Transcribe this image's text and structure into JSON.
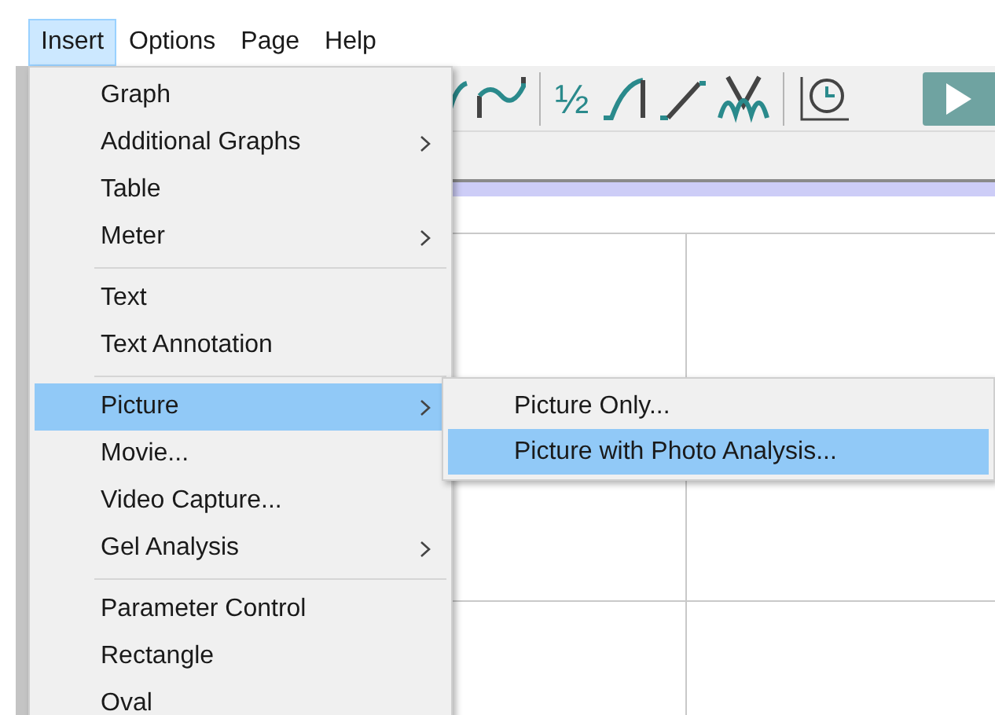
{
  "menubar": [
    {
      "label": "Insert",
      "selected": true
    },
    {
      "label": "Options",
      "selected": false
    },
    {
      "label": "Page",
      "selected": false
    },
    {
      "label": "Help",
      "selected": false
    }
  ],
  "toolbar": {
    "fraction_label": "½"
  },
  "insert_menu": [
    {
      "kind": "item",
      "label": "Graph",
      "submenu": false,
      "selected": false
    },
    {
      "kind": "item",
      "label": "Additional Graphs",
      "submenu": true,
      "selected": false
    },
    {
      "kind": "item",
      "label": "Table",
      "submenu": false,
      "selected": false
    },
    {
      "kind": "item",
      "label": "Meter",
      "submenu": true,
      "selected": false
    },
    {
      "kind": "separator"
    },
    {
      "kind": "item",
      "label": "Text",
      "submenu": false,
      "selected": false
    },
    {
      "kind": "item",
      "label": "Text Annotation",
      "submenu": false,
      "selected": false
    },
    {
      "kind": "separator"
    },
    {
      "kind": "item",
      "label": "Picture",
      "submenu": true,
      "selected": true
    },
    {
      "kind": "item",
      "label": "Movie...",
      "submenu": false,
      "selected": false
    },
    {
      "kind": "item",
      "label": "Video Capture...",
      "submenu": false,
      "selected": false
    },
    {
      "kind": "item",
      "label": "Gel Analysis",
      "submenu": true,
      "selected": false
    },
    {
      "kind": "separator"
    },
    {
      "kind": "item",
      "label": "Parameter Control",
      "submenu": false,
      "selected": false
    },
    {
      "kind": "item",
      "label": "Rectangle",
      "submenu": false,
      "selected": false
    },
    {
      "kind": "item",
      "label": "Oval",
      "submenu": false,
      "selected": false
    }
  ],
  "picture_submenu": [
    {
      "label": "Picture Only...",
      "selected": false
    },
    {
      "label": "Picture with Photo Analysis...",
      "selected": true
    }
  ]
}
